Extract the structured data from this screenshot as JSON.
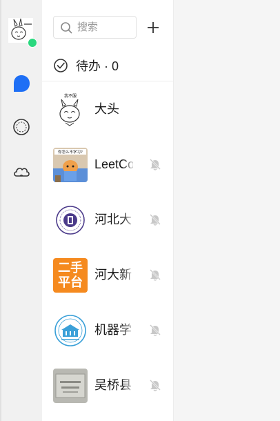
{
  "search": {
    "placeholder": "搜索"
  },
  "todo": {
    "label": "待办 · 0"
  },
  "nav": {
    "icons": [
      "chat-bubble-icon",
      "smiley-icon",
      "cloud-icon"
    ]
  },
  "colors": {
    "accent": "#1e6ff5",
    "online": "#2ad87e",
    "orange": "#f58a1f"
  },
  "chats": [
    {
      "name": "大头",
      "muted": false,
      "avatar": "rabbit-meme-avatar",
      "avatar_text": "我不服"
    },
    {
      "name": "LeetCo",
      "muted": true,
      "avatar": "cat-photo-avatar",
      "avatar_text": "你怎么不学习?"
    },
    {
      "name": "河北大",
      "muted": true,
      "avatar": "university-seal-avatar",
      "avatar_text": ""
    },
    {
      "name": "河大新",
      "muted": true,
      "avatar": "second-hand-platform-avatar",
      "avatar_text": "二手平台"
    },
    {
      "name": "机器学",
      "muted": true,
      "avatar": "building-emblem-avatar",
      "avatar_text": ""
    },
    {
      "name": "吴桥县",
      "muted": true,
      "avatar": "plaque-photo-avatar",
      "avatar_text": ""
    }
  ]
}
